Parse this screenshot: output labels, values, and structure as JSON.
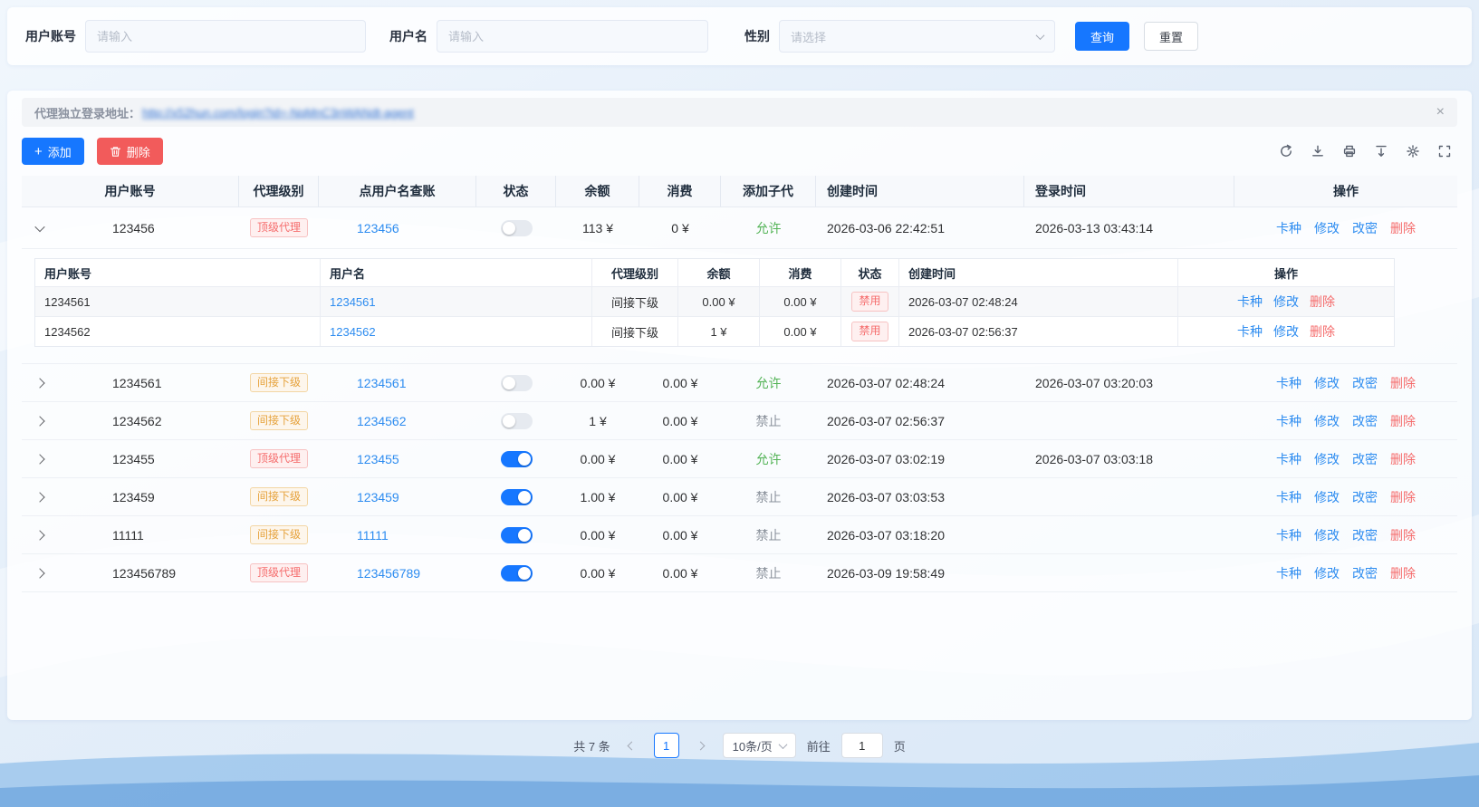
{
  "search": {
    "account_label": "用户账号",
    "account_placeholder": "请输入",
    "name_label": "用户名",
    "name_placeholder": "请输入",
    "gender_label": "性别",
    "gender_placeholder": "请选择",
    "query_label": "查询",
    "reset_label": "重置"
  },
  "banner": {
    "label": "代理独立登录地址：",
    "link_text": "http://x52hun.com/login?id=-NqMnC3nWANdt-agent"
  },
  "toolbar": {
    "add_label": "添加",
    "delete_label": "删除",
    "icons": [
      "refresh",
      "download",
      "print",
      "fit-height",
      "settings",
      "fullscreen"
    ]
  },
  "colors": {
    "primary": "#1677ff",
    "danger": "#f56c6c",
    "warning": "#e6a23c",
    "success": "#53b356",
    "link": "#2d8cf0"
  },
  "table": {
    "headers": [
      "用户账号",
      "代理级别",
      "点用户名查账",
      "状态",
      "余额",
      "消费",
      "添加子代",
      "创建时间",
      "登录时间",
      "操作"
    ],
    "action_labels": [
      "卡种",
      "修改",
      "改密",
      "删除"
    ],
    "rows": [
      {
        "account": "123456",
        "level": "顶级代理",
        "level_type": "danger",
        "name_link": "123456",
        "toggle": "off",
        "balance": "113 ¥",
        "consume": "0 ¥",
        "add_sub": "允许",
        "add_sub_type": "success",
        "created": "2026-03-06 22:42:51",
        "login": "2026-03-13 03:43:14",
        "chevron": "down"
      },
      {
        "account": "1234561",
        "level": "间接下级",
        "level_type": "warning",
        "name_link": "1234561",
        "toggle": "off",
        "balance": "0.00 ¥",
        "consume": "0.00 ¥",
        "add_sub": "允许",
        "add_sub_type": "success",
        "created": "2026-03-07 02:48:24",
        "login": "2026-03-07 03:20:03",
        "chevron": "right"
      },
      {
        "account": "1234562",
        "level": "间接下级",
        "level_type": "warning",
        "name_link": "1234562",
        "toggle": "off",
        "balance": "1 ¥",
        "consume": "0.00 ¥",
        "add_sub": "禁止",
        "add_sub_type": "muted",
        "created": "2026-03-07 02:56:37",
        "login": "",
        "chevron": "right"
      },
      {
        "account": "123455",
        "level": "顶级代理",
        "level_type": "danger",
        "name_link": "123455",
        "toggle": "on",
        "balance": "0.00 ¥",
        "consume": "0.00 ¥",
        "add_sub": "允许",
        "add_sub_type": "success",
        "created": "2026-03-07 03:02:19",
        "login": "2026-03-07 03:03:18",
        "chevron": "right"
      },
      {
        "account": "123459",
        "level": "间接下级",
        "level_type": "warning",
        "name_link": "123459",
        "toggle": "on",
        "balance": "1.00 ¥",
        "consume": "0.00 ¥",
        "add_sub": "禁止",
        "add_sub_type": "muted",
        "created": "2026-03-07 03:03:53",
        "login": "",
        "chevron": "right"
      },
      {
        "account": "11111",
        "level": "间接下级",
        "level_type": "warning",
        "name_link": "11111",
        "toggle": "on",
        "balance": "0.00 ¥",
        "consume": "0.00 ¥",
        "add_sub": "禁止",
        "add_sub_type": "muted",
        "created": "2026-03-07 03:18:20",
        "login": "",
        "chevron": "right"
      },
      {
        "account": "123456789",
        "level": "顶级代理",
        "level_type": "danger",
        "name_link": "123456789",
        "toggle": "on",
        "balance": "0.00 ¥",
        "consume": "0.00 ¥",
        "add_sub": "禁止",
        "add_sub_type": "muted",
        "created": "2026-03-09 19:58:49",
        "login": "",
        "chevron": "right"
      }
    ]
  },
  "subtable": {
    "headers": [
      "用户账号",
      "用户名",
      "代理级别",
      "余额",
      "消费",
      "状态",
      "创建时间",
      "操作"
    ],
    "action_labels": [
      "卡种",
      "修改",
      "删除"
    ],
    "rows": [
      {
        "account": "1234561",
        "name_link": "1234561",
        "level": "间接下级",
        "balance": "0.00 ¥",
        "consume": "0.00 ¥",
        "status": "禁用",
        "status_type": "danger",
        "created": "2026-03-07 02:48:24"
      },
      {
        "account": "1234562",
        "name_link": "1234562",
        "level": "间接下级",
        "balance": "1 ¥",
        "consume": "0.00 ¥",
        "status": "禁用",
        "status_type": "danger",
        "created": "2026-03-07 02:56:37"
      }
    ]
  },
  "pagination": {
    "total": "共 7 条",
    "current_page": "1",
    "page_size": "10条/页",
    "goto_label": "前往",
    "goto_value": "1",
    "goto_suffix": "页"
  }
}
